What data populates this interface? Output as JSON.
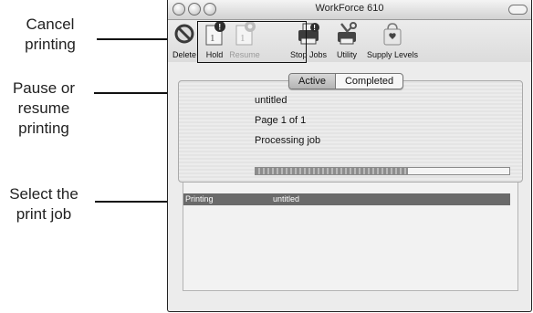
{
  "callouts": {
    "cancel": "Cancel\nprinting",
    "pause": "Pause or\nresume\nprinting",
    "select": "Select the\nprint job"
  },
  "window": {
    "title": "WorkForce 610"
  },
  "toolbar": {
    "delete_label": "Delete",
    "hold_label": "Hold",
    "resume_label": "Resume",
    "stop_jobs_label": "Stop Jobs",
    "utility_label": "Utility",
    "supply_levels_label": "Supply Levels"
  },
  "tabs": {
    "active_label": "Active",
    "completed_label": "Completed"
  },
  "job": {
    "name": "untitled",
    "page": "Page 1 of 1",
    "status": "Processing job",
    "progress": 0.6
  },
  "queue": {
    "rows": [
      {
        "status": "Printing",
        "name": "untitled"
      }
    ]
  }
}
